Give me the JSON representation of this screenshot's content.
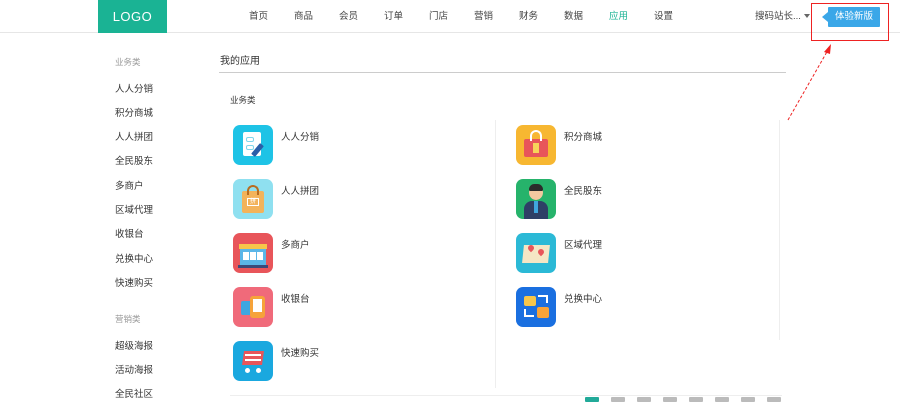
{
  "header": {
    "logo": "LOGO",
    "nav": [
      "首页",
      "商品",
      "会员",
      "订单",
      "门店",
      "营销",
      "财务",
      "数据",
      "应用",
      "设置"
    ],
    "active_nav": "应用",
    "user": "搜码站长...",
    "try_button": "体验新版"
  },
  "sidebar": {
    "groups": [
      {
        "label": "业务类",
        "items": [
          "人人分销",
          "积分商城",
          "人人拼团",
          "全民股东",
          "多商户",
          "区域代理",
          "收银台",
          "兑换中心",
          "快速购买"
        ]
      },
      {
        "label": "营销类",
        "items": [
          "超级海报",
          "活动海报",
          "全民社区"
        ]
      }
    ]
  },
  "main": {
    "title": "我的应用",
    "section": "业务类",
    "apps_left": [
      {
        "name": "人人分销",
        "icon": "distribution-icon",
        "color": "#1ec3e6"
      },
      {
        "name": "人人拼团",
        "icon": "group-buy-icon",
        "color": "#8fe0f0"
      },
      {
        "name": "多商户",
        "icon": "multi-merchant-icon",
        "color": "#e8555a"
      },
      {
        "name": "收银台",
        "icon": "cashier-icon",
        "color": "#f06a7a"
      },
      {
        "name": "快速购买",
        "icon": "quick-buy-icon",
        "color": "#1aa8df"
      }
    ],
    "apps_right": [
      {
        "name": "积分商城",
        "icon": "points-mall-icon",
        "color": "#f7b731"
      },
      {
        "name": "全民股东",
        "icon": "shareholder-icon",
        "color": "#26b36b"
      },
      {
        "name": "区域代理",
        "icon": "regional-agent-icon",
        "color": "#2bb9d6"
      },
      {
        "name": "兑换中心",
        "icon": "exchange-center-icon",
        "color": "#1a6fe0"
      }
    ]
  },
  "colors": {
    "brand": "#1ab394",
    "accent": "#3aa7e8",
    "highlight": "#e22222"
  }
}
